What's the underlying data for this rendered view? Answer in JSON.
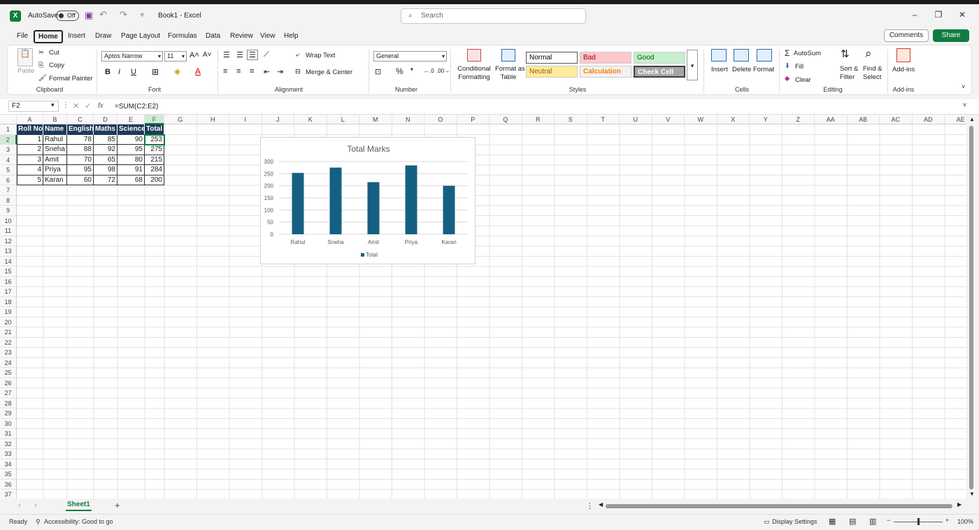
{
  "titlebar": {
    "app_icon": "X",
    "autosave_label": "AutoSave",
    "autosave_state": "Off",
    "title": "Book1  -  Excel",
    "search_placeholder": "Search"
  },
  "tabs": [
    "File",
    "Home",
    "Insert",
    "Draw",
    "Page Layout",
    "Formulas",
    "Data",
    "Review",
    "View",
    "Help"
  ],
  "active_tab": "Home",
  "actions": {
    "comments": "Comments",
    "share": "Share"
  },
  "ribbon": {
    "clipboard": {
      "paste": "Paste",
      "cut": "Cut",
      "copy": "Copy",
      "format_painter": "Format Painter",
      "label": "Clipboard"
    },
    "font": {
      "name": "Aptos Narrow",
      "size": "11",
      "bold": "B",
      "italic": "I",
      "underline": "U",
      "label": "Font"
    },
    "alignment": {
      "wrap_text": "Wrap Text",
      "merge_center": "Merge & Center",
      "label": "Alignment"
    },
    "number": {
      "format": "General",
      "label": "Number"
    },
    "styles": {
      "conditional": [
        "Conditional",
        "Formatting"
      ],
      "format_as_table": [
        "Format as",
        "Table"
      ],
      "cells": [
        {
          "name": "Normal",
          "bg": "#ffffff",
          "fg": "#000000"
        },
        {
          "name": "Bad",
          "bg": "#ffc7ce",
          "fg": "#9c0006"
        },
        {
          "name": "Good",
          "bg": "#c6efce",
          "fg": "#006100"
        },
        {
          "name": "Neutral",
          "bg": "#ffeb9c",
          "fg": "#9c5700"
        },
        {
          "name": "Calculation",
          "bg": "#f2f2f2",
          "fg": "#fa7d00"
        },
        {
          "name": "Check Cell",
          "bg": "#a5a5a5",
          "fg": "#ffffff"
        }
      ],
      "label": "Styles"
    },
    "cells": {
      "insert": "Insert",
      "delete": "Delete",
      "format": "Format",
      "label": "Cells"
    },
    "editing": {
      "autosum": "AutoSum",
      "fill": "Fill",
      "clear": "Clear",
      "sort_filter": [
        "Sort &",
        "Filter"
      ],
      "find_select": [
        "Find &",
        "Select"
      ],
      "label": "Editing"
    },
    "addins": {
      "button": "Add-ins",
      "label": "Add-ins"
    }
  },
  "formula_bar": {
    "name_box": "F2",
    "fx": "fx",
    "formula": "=SUM(C2:E2)"
  },
  "columns": [
    "A",
    "B",
    "C",
    "D",
    "E",
    "F",
    "G",
    "H",
    "I",
    "J",
    "K",
    "L",
    "M",
    "N",
    "O",
    "P",
    "Q",
    "R",
    "S",
    "T",
    "U",
    "V",
    "W",
    "X",
    "Y",
    "Z",
    "AA",
    "AB",
    "AC",
    "AD",
    "AE"
  ],
  "row_count": 37,
  "table": {
    "headers": [
      "Roll No",
      "Name",
      "English",
      "Maths",
      "Science",
      "Total"
    ],
    "rows": [
      [
        "1",
        "Rahul",
        "78",
        "85",
        "90",
        "253"
      ],
      [
        "2",
        "Sneha",
        "88",
        "92",
        "95",
        "275"
      ],
      [
        "3",
        "Amit",
        "70",
        "65",
        "80",
        "215"
      ],
      [
        "4",
        "Priya",
        "95",
        "98",
        "91",
        "284"
      ],
      [
        "5",
        "Karan",
        "60",
        "72",
        "68",
        "200"
      ]
    ]
  },
  "chart_data": {
    "type": "bar",
    "title": "Total Marks",
    "categories": [
      "Rahul",
      "Sneha",
      "Amit",
      "Priya",
      "Karan"
    ],
    "series": [
      {
        "name": "Total",
        "values": [
          253,
          275,
          215,
          284,
          200
        ],
        "color": "#156082"
      }
    ],
    "ylim": [
      0,
      300
    ],
    "yticks": [
      0,
      50,
      100,
      150,
      200,
      250,
      300
    ],
    "grid": true,
    "legend": "bottom",
    "xlabel": "",
    "ylabel": ""
  },
  "sheetbar": {
    "sheet": "Sheet1",
    "add": "+"
  },
  "status": {
    "ready": "Ready",
    "accessibility": "Accessibility: Good to go",
    "display_settings": "Display Settings",
    "zoom": "100%"
  },
  "colors": {
    "accent": "#107c41",
    "header_fill": "#1f3a5a",
    "bar": "#156082"
  }
}
